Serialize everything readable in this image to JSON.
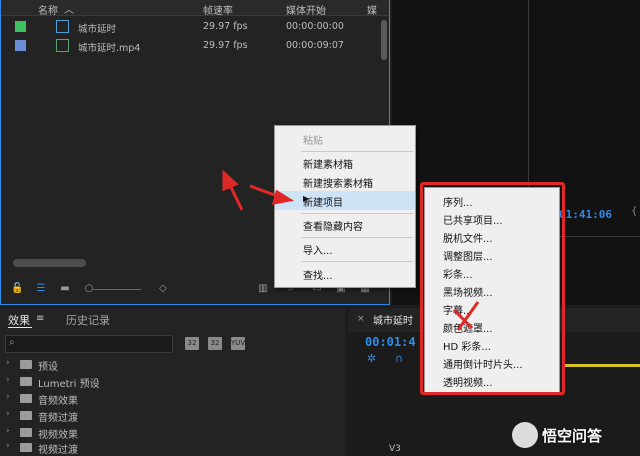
{
  "project_panel": {
    "columns": {
      "name": "名称",
      "fps": "帧速率",
      "media_start": "媒体开始",
      "truncated": "媒"
    },
    "items": [
      {
        "name": "城市延时",
        "fps": "29.97 fps",
        "start": "00:00:00:00",
        "color": "#3fbf5f"
      },
      {
        "name": "城市延时.mp4",
        "fps": "29.97 fps",
        "start": "00:00:09:07",
        "color": "#6b8fd6"
      }
    ],
    "accent": "#2d8ceb"
  },
  "context_menu": {
    "items": [
      {
        "label": "粘贴",
        "disabled": true
      },
      {
        "label": "新建素材箱"
      },
      {
        "label": "新建搜索素材箱"
      },
      {
        "label": "新建项目",
        "has_submenu": true
      },
      {
        "label": "查看隐藏内容"
      },
      {
        "label": "导入..."
      },
      {
        "label": "查找..."
      }
    ]
  },
  "submenu": {
    "items": [
      "序列...",
      "已共享项目...",
      "脱机文件...",
      "调整图层...",
      "彩条...",
      "黑场视频...",
      "字幕...",
      "颜色遮罩...",
      "HD 彩条...",
      "通用倒计时片头...",
      "透明视频..."
    ]
  },
  "effects_panel": {
    "tabs": {
      "effects": "效果",
      "history": "历史记录"
    },
    "buttons": [
      "32",
      "32",
      "YUV"
    ],
    "tree": [
      "预设",
      "Lumetri 预设",
      "音频效果",
      "音频过渡",
      "视频效果",
      "视频过渡"
    ]
  },
  "timeline": {
    "tab": "城市延时",
    "timecode": "00:01:4",
    "source_timecode": "01:41:06",
    "track": "V3"
  },
  "watermark": {
    "text": "悟空问答"
  }
}
